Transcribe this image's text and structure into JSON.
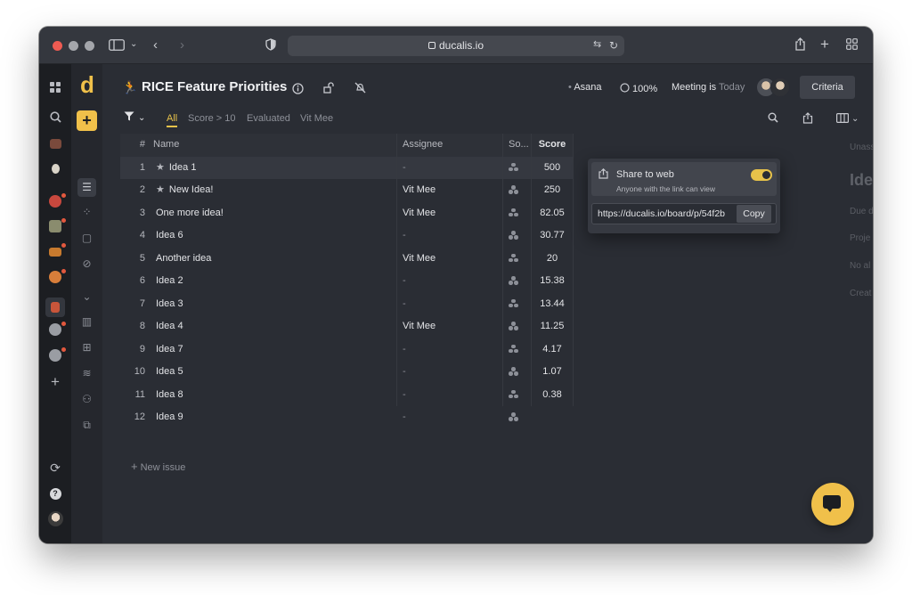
{
  "browser": {
    "url": "ducalis.io",
    "translate_icon": "translate-icon",
    "reload_icon": "reload-icon"
  },
  "rail": {
    "items": [
      {
        "icon": "grid-icon"
      },
      {
        "icon": "search-icon"
      },
      {
        "icon": "project-emoji-icon"
      },
      {
        "icon": "bulb-icon"
      },
      {
        "icon": "target-emoji-icon"
      },
      {
        "icon": "calendar-emoji-icon"
      },
      {
        "icon": "pie-emoji-icon"
      },
      {
        "icon": "smile-emoji-icon"
      },
      {
        "icon": "runner-emoji-icon"
      },
      {
        "icon": "ball-emoji-icon"
      },
      {
        "icon": "ball-emoji-icon"
      },
      {
        "icon": "plus-icon"
      },
      {
        "icon": "sync-icon"
      },
      {
        "icon": "help-icon"
      },
      {
        "icon": "user-avatar"
      }
    ]
  },
  "nav2": {
    "logo": "d",
    "add": "+",
    "items": [
      "list-icon",
      "nodes-icon",
      "board-icon",
      "mute-icon",
      "chevron-down-icon",
      "columns-icon",
      "apps-icon",
      "layers-icon",
      "team-icon",
      "copy-icon"
    ]
  },
  "header": {
    "emoji": "🏃",
    "title": "RICE Feature Priorities",
    "integration": "Asana",
    "progress": "100%",
    "meeting_label": "Meeting is",
    "meeting_value": "Today",
    "criteria": "Criteria"
  },
  "filters": {
    "tabs": [
      "All",
      "Score > 10",
      "Evaluated",
      "Vit Mee"
    ],
    "active": 0
  },
  "table": {
    "headers": {
      "num": "#",
      "name": "Name",
      "assignee": "Assignee",
      "so": "So...",
      "score": "Score"
    },
    "rows": [
      {
        "num": "1",
        "name": "Idea 1",
        "starred": true,
        "assignee": "-",
        "score": "500"
      },
      {
        "num": "2",
        "name": "New Idea!",
        "starred": true,
        "assignee": "Vit Mee",
        "score": "250"
      },
      {
        "num": "3",
        "name": "One more idea!",
        "starred": false,
        "assignee": "Vit Mee",
        "score": "82.05"
      },
      {
        "num": "4",
        "name": "Idea 6",
        "starred": false,
        "assignee": "-",
        "score": "30.77"
      },
      {
        "num": "5",
        "name": "Another idea",
        "starred": false,
        "assignee": "Vit Mee",
        "score": "20"
      },
      {
        "num": "6",
        "name": "Idea 2",
        "starred": false,
        "assignee": "-",
        "score": "15.38"
      },
      {
        "num": "7",
        "name": "Idea 3",
        "starred": false,
        "assignee": "-",
        "score": "13.44"
      },
      {
        "num": "8",
        "name": "Idea 4",
        "starred": false,
        "assignee": "Vit Mee",
        "score": "11.25"
      },
      {
        "num": "9",
        "name": "Idea 7",
        "starred": false,
        "assignee": "-",
        "score": "4.17"
      },
      {
        "num": "10",
        "name": "Idea 5",
        "starred": false,
        "assignee": "-",
        "score": "1.07"
      },
      {
        "num": "11",
        "name": "Idea 8",
        "starred": false,
        "assignee": "-",
        "score": "0.38"
      },
      {
        "num": "12",
        "name": "Idea 9",
        "starred": false,
        "assignee": "-",
        "score": ""
      }
    ],
    "new_issue": "New issue"
  },
  "share_popup": {
    "title": "Share to web",
    "subtitle": "Anyone with the link can view",
    "enabled": true,
    "url": "https://ducalis.io/board/p/54f2b",
    "copy": "Copy"
  },
  "right_panel": {
    "lines": [
      "Unass",
      "Ide",
      "Due d",
      "Proje",
      "No al",
      "Creat"
    ]
  },
  "colors": {
    "accent": "#f0c04a",
    "background": "#2a2d34",
    "sidebar": "#1c1e22"
  }
}
